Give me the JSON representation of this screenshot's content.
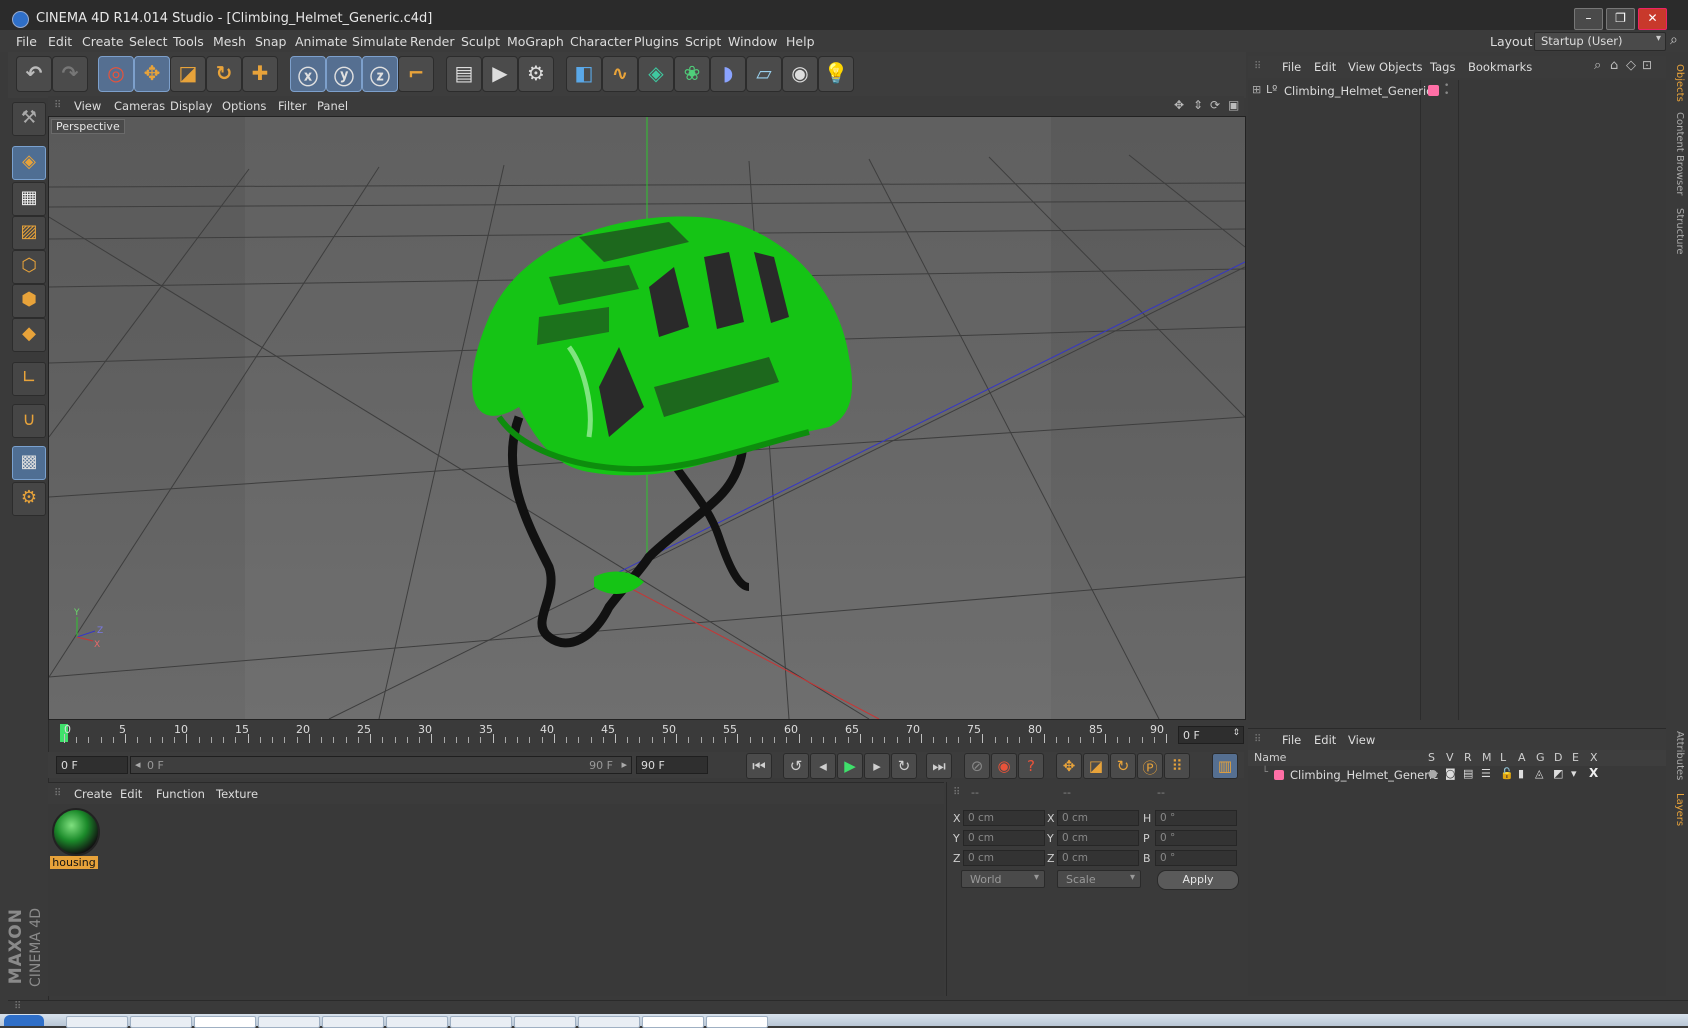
{
  "window": {
    "title": "CINEMA 4D R14.014 Studio - [Climbing_Helmet_Generic.c4d]"
  },
  "menubar": {
    "items": [
      "File",
      "Edit",
      "Create",
      "Select",
      "Tools",
      "Mesh",
      "Snap",
      "Animate",
      "Simulate",
      "Render",
      "Sculpt",
      "MoGraph",
      "Character",
      "Plugins",
      "Script",
      "Window",
      "Help"
    ],
    "layout_label": "Layout:",
    "layout_value": "Startup (User)"
  },
  "viewport": {
    "menu": [
      "View",
      "Cameras",
      "Display",
      "Options",
      "Filter",
      "Panel"
    ],
    "label": "Perspective"
  },
  "timeline": {
    "ticks": [
      "0",
      "5",
      "10",
      "15",
      "20",
      "25",
      "30",
      "35",
      "40",
      "45",
      "50",
      "55",
      "60",
      "65",
      "70",
      "75",
      "80",
      "85",
      "90"
    ],
    "current_frame": "0 F",
    "start_field": "0 F",
    "slider_start": "0 F",
    "slider_end": "90 F",
    "end_field": "90 F"
  },
  "material_manager": {
    "menu": [
      "Create",
      "Edit",
      "Function",
      "Texture"
    ],
    "material_name": "housing"
  },
  "coordinates": {
    "header": [
      "--",
      "--",
      "--"
    ],
    "rows": [
      {
        "l1": "X",
        "v1": "0 cm",
        "l2": "X",
        "v2": "0 cm",
        "l3": "H",
        "v3": "0 °"
      },
      {
        "l1": "Y",
        "v1": "0 cm",
        "l2": "Y",
        "v2": "0 cm",
        "l3": "P",
        "v3": "0 °"
      },
      {
        "l1": "Z",
        "v1": "0 cm",
        "l2": "Z",
        "v2": "0 cm",
        "l3": "B",
        "v3": "0 °"
      }
    ],
    "mode": "World",
    "mode2": "Scale",
    "apply": "Apply"
  },
  "object_manager": {
    "menu": [
      "File",
      "Edit",
      "View",
      "Objects",
      "Tags",
      "Bookmarks"
    ],
    "objects": [
      {
        "name": "Climbing_Helmet_Generic",
        "layer_color": "#ff6fa6"
      }
    ]
  },
  "layer_manager": {
    "menu": [
      "File",
      "Edit",
      "View"
    ],
    "columns": [
      "Name",
      "S",
      "V",
      "R",
      "M",
      "L",
      "A",
      "G",
      "D",
      "E",
      "X"
    ],
    "layers": [
      {
        "name": "Climbing_Helmet_Generic",
        "color": "#ff6fa6"
      }
    ]
  },
  "side_tabs": [
    "Objects",
    "Content Browser",
    "Structure",
    "Attributes",
    "Layers"
  ],
  "brand": {
    "maxon": "MAXON",
    "c4d": "CINEMA 4D"
  },
  "colors": {
    "accent": "#e8a33a",
    "helmet": "#15c415",
    "active_tool": "#556f91"
  }
}
